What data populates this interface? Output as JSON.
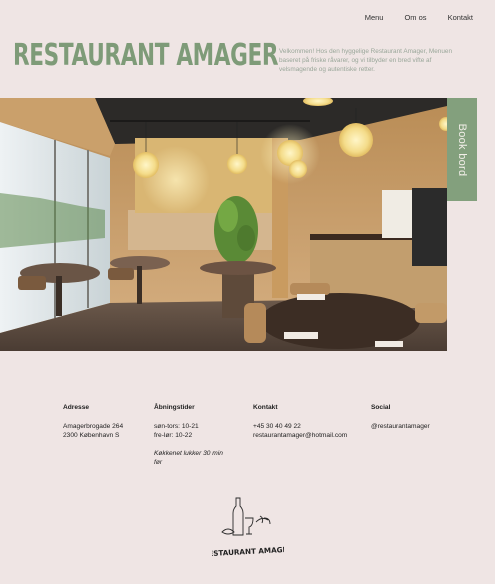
{
  "nav": {
    "items": [
      "Menu",
      "Om os",
      "Kontakt"
    ]
  },
  "brand": {
    "title": "RESTAURANT AMAGER"
  },
  "intro": {
    "text": "Velkommen! Hos den hyggelige Restaurant Amager, Menuen baseret på friske råvarer, og vi tilbyder en bred vifte af velsmagende og autentiske retter."
  },
  "book_button": {
    "label": "Book bord"
  },
  "hero": {
    "image": "restaurant-interior-photo"
  },
  "footer": {
    "address": {
      "heading": "Adresse",
      "line1": "Amagerbrogade 264",
      "line2": "2300 København S"
    },
    "hours": {
      "heading": "Åbningstider",
      "line1": "søn-tors: 10-21",
      "line2": "fre-lør: 10-22",
      "note": "Køkkenet lukker 30 min før"
    },
    "contact": {
      "heading": "Kontakt",
      "phone": "+45 30 40 49 22",
      "email": "restaurantamager@hotmail.com"
    },
    "social": {
      "heading": "Social",
      "handle": "@restaurantamager"
    },
    "logo_text": "RESTAURANT AMAGER"
  },
  "colors": {
    "background": "#efe5e4",
    "accent": "#7e9b78",
    "button": "#83a07d"
  }
}
